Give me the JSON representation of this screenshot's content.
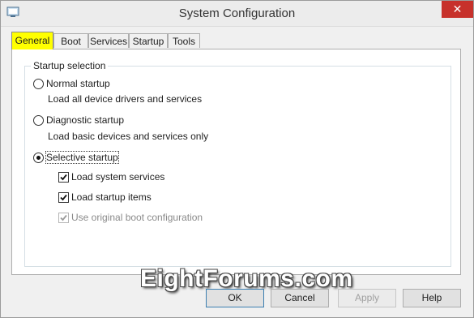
{
  "window": {
    "title": "System Configuration",
    "close_symbol": "✕"
  },
  "tabs": [
    {
      "label": "General",
      "active": true
    },
    {
      "label": "Boot"
    },
    {
      "label": "Services"
    },
    {
      "label": "Startup"
    },
    {
      "label": "Tools"
    }
  ],
  "startup_selection": {
    "legend": "Startup selection",
    "normal": {
      "label": "Normal startup",
      "description": "Load all device drivers and services",
      "selected": false
    },
    "diagnostic": {
      "label": "Diagnostic startup",
      "description": "Load basic devices and services only",
      "selected": false
    },
    "selective": {
      "label": "Selective startup",
      "selected": true,
      "options": [
        {
          "label": "Load system services",
          "checked": true,
          "enabled": true
        },
        {
          "label": "Load startup items",
          "checked": true,
          "enabled": true
        },
        {
          "label": "Use original boot configuration",
          "checked": true,
          "enabled": false
        }
      ]
    }
  },
  "watermark": "EightForums.com",
  "buttons": {
    "ok": "OK",
    "cancel": "Cancel",
    "apply": "Apply",
    "help": "Help"
  },
  "colors": {
    "tab_highlight": "#ffff00",
    "close_button": "#c7312b"
  }
}
